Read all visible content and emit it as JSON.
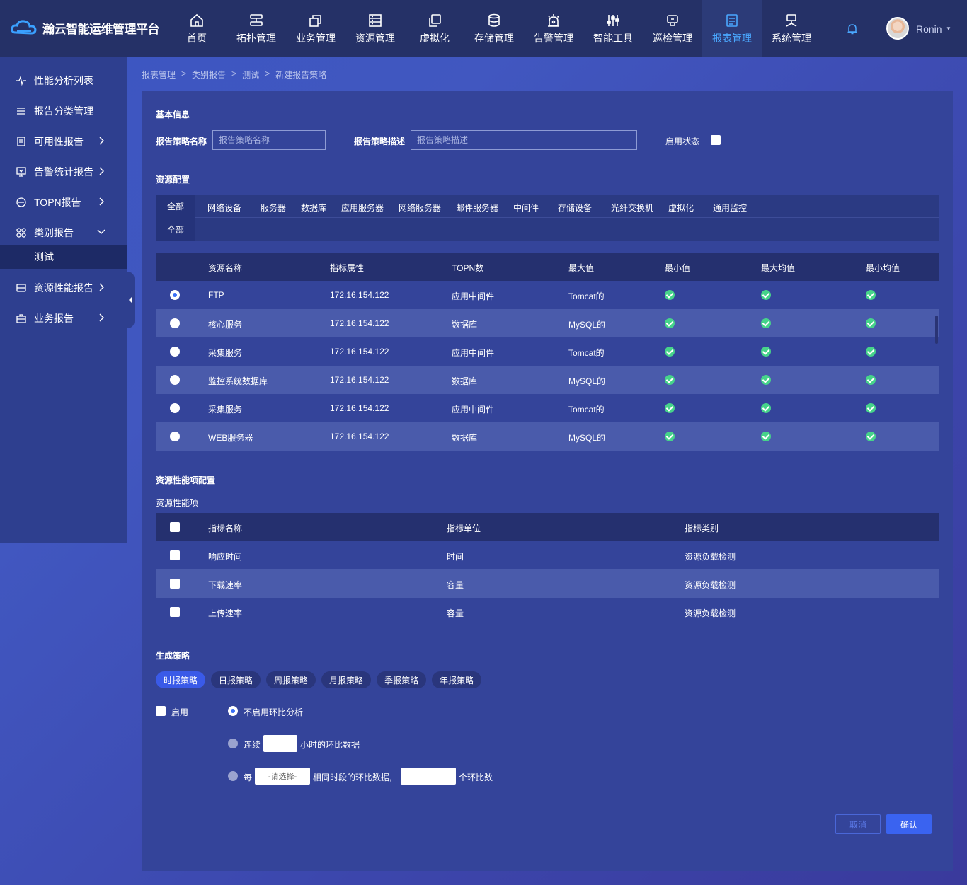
{
  "app": {
    "title": "瀚云智能运维管理平台"
  },
  "nav": [
    {
      "label": "首页",
      "icon": "home-icon"
    },
    {
      "label": "拓扑管理",
      "icon": "topology-icon"
    },
    {
      "label": "业务管理",
      "icon": "business-icon"
    },
    {
      "label": "资源管理",
      "icon": "resource-icon"
    },
    {
      "label": "虚拟化",
      "icon": "virtualization-icon"
    },
    {
      "label": "存储管理",
      "icon": "storage-icon"
    },
    {
      "label": "告警管理",
      "icon": "alarm-icon"
    },
    {
      "label": "智能工具",
      "icon": "tools-icon"
    },
    {
      "label": "巡检管理",
      "icon": "inspection-icon"
    },
    {
      "label": "报表管理",
      "icon": "report-icon",
      "active": true
    },
    {
      "label": "系统管理",
      "icon": "system-icon"
    }
  ],
  "user": {
    "name": "Ronin"
  },
  "sidebar": {
    "items": [
      {
        "label": "性能分析列表"
      },
      {
        "label": "报告分类管理"
      },
      {
        "label": "可用性报告"
      },
      {
        "label": "告警统计报告"
      },
      {
        "label": "TOPN报告"
      },
      {
        "label": "类别报告"
      },
      {
        "label": "资源性能报告"
      },
      {
        "label": "业务报告"
      }
    ],
    "sub": "测试"
  },
  "breadcrumb": [
    "报表管理",
    ">",
    "类别报告",
    ">",
    "测试",
    ">",
    "新建报告策略"
  ],
  "basic": {
    "title": "基本信息",
    "name_label": "报告策略名称",
    "name_placeholder": "报告策略名称",
    "desc_label": "报告策略描述",
    "desc_placeholder": "报告策略描述",
    "enable_label": "启用状态"
  },
  "resource": {
    "title": "资源配置",
    "categories": [
      "全部",
      "网络设备",
      "服务器",
      "数据库",
      "应用服务器",
      "网络服务器",
      "邮件服务器",
      "中间件",
      "存储设备",
      "光纤交换机",
      "虚拟化",
      "通用监控"
    ],
    "sub_all": "全部",
    "headers": [
      "资源名称",
      "指标属性",
      "TOPN数",
      "最大值",
      "最小值",
      "最大均值",
      "最小均值"
    ],
    "rows": [
      {
        "name": "FTP",
        "ip": "172.16.154.122",
        "type": "应用中间件",
        "max": "Tomcat的",
        "selected": true
      },
      {
        "name": "核心服务",
        "ip": "172.16.154.122",
        "type": "数据库",
        "max": "MySQL的",
        "selected": false
      },
      {
        "name": "采集服务",
        "ip": "172.16.154.122",
        "type": "应用中间件",
        "max": "Tomcat的",
        "selected": false
      },
      {
        "name": "监控系统数据库",
        "ip": "172.16.154.122",
        "type": "数据库",
        "max": "MySQL的",
        "selected": false
      },
      {
        "name": "采集服务",
        "ip": "172.16.154.122",
        "type": "应用中间件",
        "max": "Tomcat的",
        "selected": false
      },
      {
        "name": "WEB服务器",
        "ip": "172.16.154.122",
        "type": "数据库",
        "max": "MySQL的",
        "selected": false
      }
    ]
  },
  "perf": {
    "title": "资源性能项配置",
    "subtitle": "资源性能项",
    "headers": [
      "指标名称",
      "指标单位",
      "指标类别"
    ],
    "rows": [
      {
        "name": "响应时间",
        "unit": "时间",
        "cat": "资源负载检测"
      },
      {
        "name": "下载速率",
        "unit": "容量",
        "cat": "资源负载检测"
      },
      {
        "name": "上传速率",
        "unit": "容量",
        "cat": "资源负载检测"
      }
    ]
  },
  "strategy": {
    "title": "生成策略",
    "tabs": [
      "时报策略",
      "日报策略",
      "周报策略",
      "月报策略",
      "季报策略",
      "年报策略"
    ],
    "enable": "启用",
    "opt1": "不启用环比分析",
    "opt2_pre": "连续",
    "opt2_post": "小时的环比数据",
    "opt3_pre": "每",
    "opt3_select": "-请选择-",
    "opt3_mid": "相同时段的环比数据,",
    "opt3_post": "个环比数"
  },
  "actions": {
    "cancel": "取消",
    "confirm": "确认"
  },
  "colors": {
    "accent": "#3a63f0",
    "ok": "#46d38a",
    "active_nav": "#4aa8ff"
  }
}
